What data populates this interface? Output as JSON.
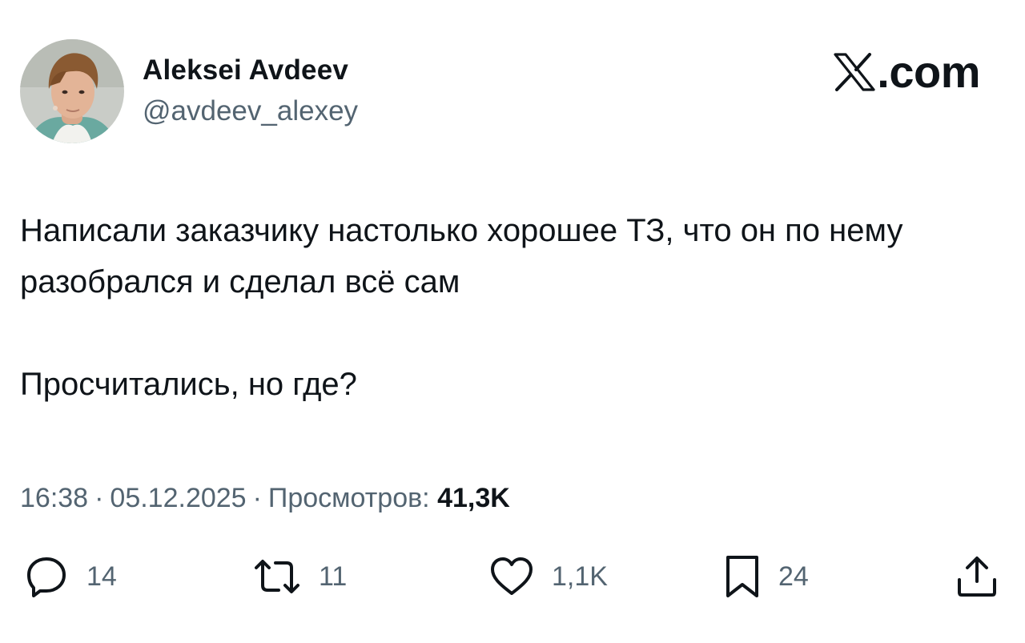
{
  "author": {
    "name": "Aleksei Avdeev",
    "handle": "@avdeev_alexey"
  },
  "brand": {
    "icon": "x-logo-icon",
    "domain": ".com"
  },
  "tweet": {
    "paragraphs": [
      "Написали заказчику настолько хорошее ТЗ, что он по нему разобрался и сделал всё сам",
      "Просчитались, но где?"
    ]
  },
  "meta": {
    "time": "16:38",
    "separator": "·",
    "date": "05.12.2025",
    "views_label": "Просмотров:",
    "views_count": "41,3K"
  },
  "actions": {
    "reply": {
      "icon": "reply-icon",
      "count": "14"
    },
    "retweet": {
      "icon": "retweet-icon",
      "count": "11"
    },
    "like": {
      "icon": "heart-icon",
      "count": "1,1K"
    },
    "bookmark": {
      "icon": "bookmark-icon",
      "count": "24"
    },
    "share": {
      "icon": "share-icon"
    }
  },
  "colors": {
    "text_primary": "#0f1419",
    "text_secondary": "#536471",
    "background": "#ffffff"
  }
}
